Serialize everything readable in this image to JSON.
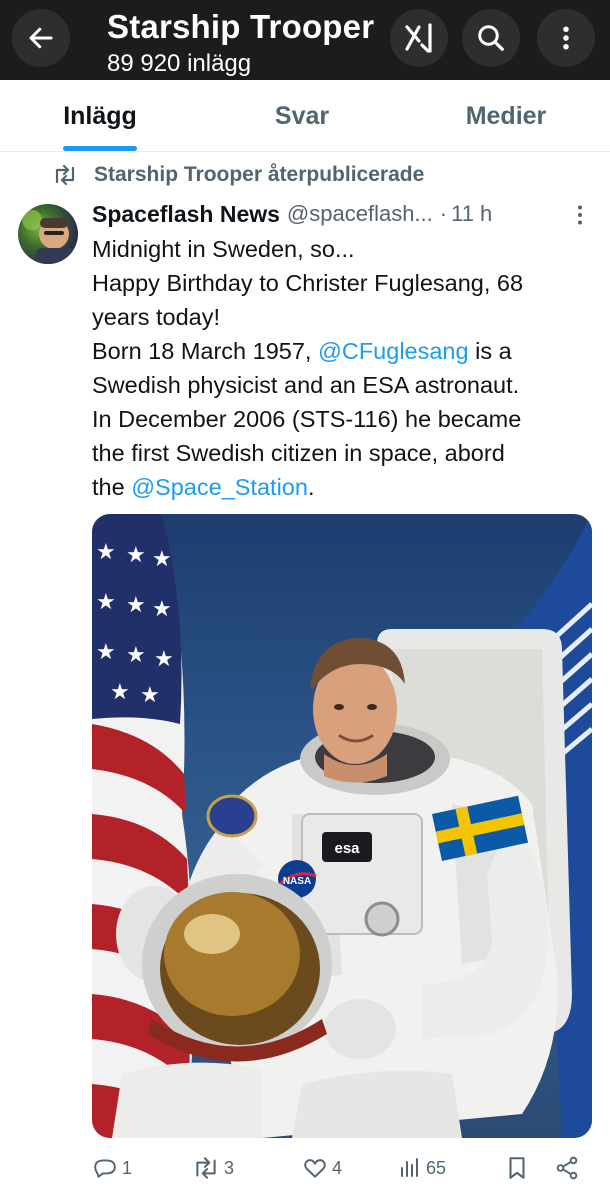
{
  "header": {
    "title": "Starship Trooper",
    "post_count": "89 920 inlägg"
  },
  "tabs": [
    {
      "label": "Inlägg",
      "active": true
    },
    {
      "label": "Svar",
      "active": false
    },
    {
      "label": "Medier",
      "active": false
    }
  ],
  "repost": {
    "label": "Starship Trooper återpublicerade"
  },
  "tweet": {
    "author_name": "Spaceflash News",
    "author_handle": "@spaceflash...",
    "separator": "·",
    "time": "11 h",
    "text_lines": [
      {
        "text": "Midnight in Sweden, so..."
      },
      {
        "text": "Happy Birthday to Christer Fuglesang, 68"
      },
      {
        "text": "years today!"
      },
      {
        "before": "Born 18 March 1957, ",
        "mention": "@CFuglesang",
        "after": " is a"
      },
      {
        "text": "Swedish physicist and an ESA astronaut."
      },
      {
        "text": "In December 2006 (STS-116) he became"
      },
      {
        "text": "the first Swedish citizen in space, abord"
      },
      {
        "before": "the ",
        "mention": "@Space_Station",
        "after": "."
      }
    ],
    "media": {
      "patch_esa": "esa",
      "patch_nasa": "NASA"
    },
    "stats": {
      "replies": "1",
      "reposts": "3",
      "likes": "4",
      "views": "65"
    }
  },
  "colors": {
    "accent": "#1d9bf0",
    "header_bg": "#1c1c1c",
    "muted_text": "#536471"
  }
}
